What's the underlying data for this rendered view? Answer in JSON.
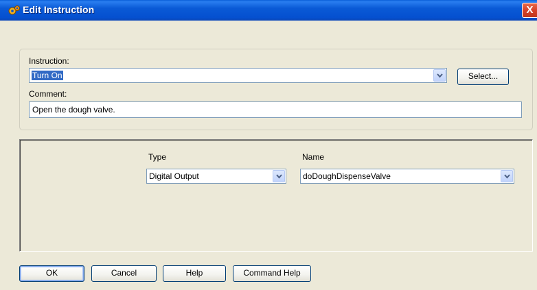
{
  "window": {
    "title": "Edit Instruction",
    "close_label": "X"
  },
  "instruction": {
    "label": "Instruction:",
    "value": "Turn On",
    "select_button": "Select..."
  },
  "comment": {
    "label": "Comment:",
    "value": "Open the dough valve."
  },
  "params": {
    "type_label": "Type",
    "type_value": "Digital Output",
    "name_label": "Name",
    "name_value": "doDoughDispenseValve"
  },
  "buttons": {
    "ok": "OK",
    "cancel": "Cancel",
    "help": "Help",
    "command_help": "Command Help"
  },
  "colors": {
    "titlebar": "#0550d0",
    "dialog_bg": "#ece9d8",
    "selection": "#316ac5",
    "close": "#d8422a"
  }
}
